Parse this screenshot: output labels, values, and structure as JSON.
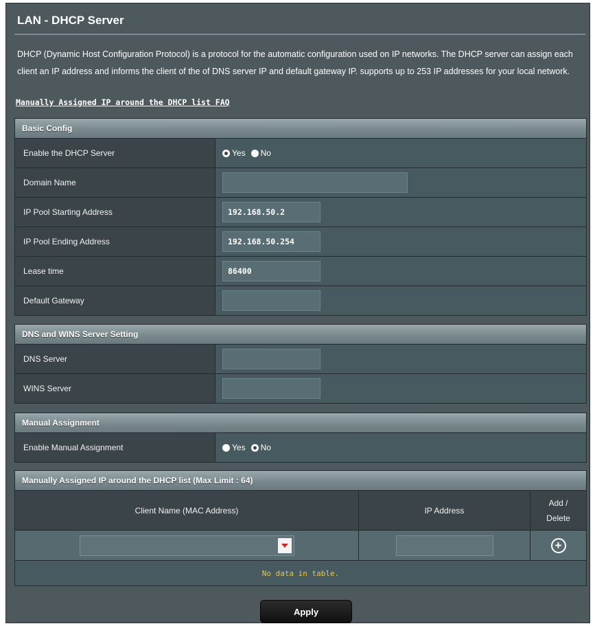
{
  "page": {
    "title": "LAN - DHCP Server",
    "description": "DHCP (Dynamic Host Configuration Protocol) is a protocol for the automatic configuration used on IP networks. The DHCP server can assign each client an IP address and informs the client of the of DNS server IP and default gateway IP. supports up to 253 IP addresses for your local network.",
    "faq_link": "Manually Assigned IP around the DHCP list FAQ"
  },
  "basic_config": {
    "header": "Basic Config",
    "enable_dhcp": {
      "label": "Enable the DHCP Server",
      "yes": "Yes",
      "no": "No",
      "selected": "Yes"
    },
    "domain_name": {
      "label": "Domain Name",
      "value": ""
    },
    "pool_start": {
      "label": "IP Pool Starting Address",
      "value": "192.168.50.2"
    },
    "pool_end": {
      "label": "IP Pool Ending Address",
      "value": "192.168.50.254"
    },
    "lease_time": {
      "label": "Lease time",
      "value": "86400"
    },
    "default_gateway": {
      "label": "Default Gateway",
      "value": ""
    }
  },
  "dns_wins": {
    "header": "DNS and WINS Server Setting",
    "dns_server": {
      "label": "DNS Server",
      "value": ""
    },
    "wins_server": {
      "label": "WINS Server",
      "value": ""
    }
  },
  "manual_assignment": {
    "header": "Manual Assignment",
    "enable": {
      "label": "Enable Manual Assignment",
      "yes": "Yes",
      "no": "No",
      "selected": "No"
    }
  },
  "manual_list": {
    "header": "Manually Assigned IP around the DHCP list (Max Limit : 64)",
    "col_client": "Client Name (MAC Address)",
    "col_ip": "IP Address",
    "col_add_delete": "Add / Delete",
    "empty_message": "No data in table.",
    "add_icon": "plus-circle-icon",
    "dropdown_icon": "dropdown-arrow-icon"
  },
  "actions": {
    "apply": "Apply"
  },
  "colors": {
    "panel": "#4d595d",
    "label_cell": "#3b4448",
    "empty_text": "#e8c84a",
    "arrow": "#c62828"
  }
}
